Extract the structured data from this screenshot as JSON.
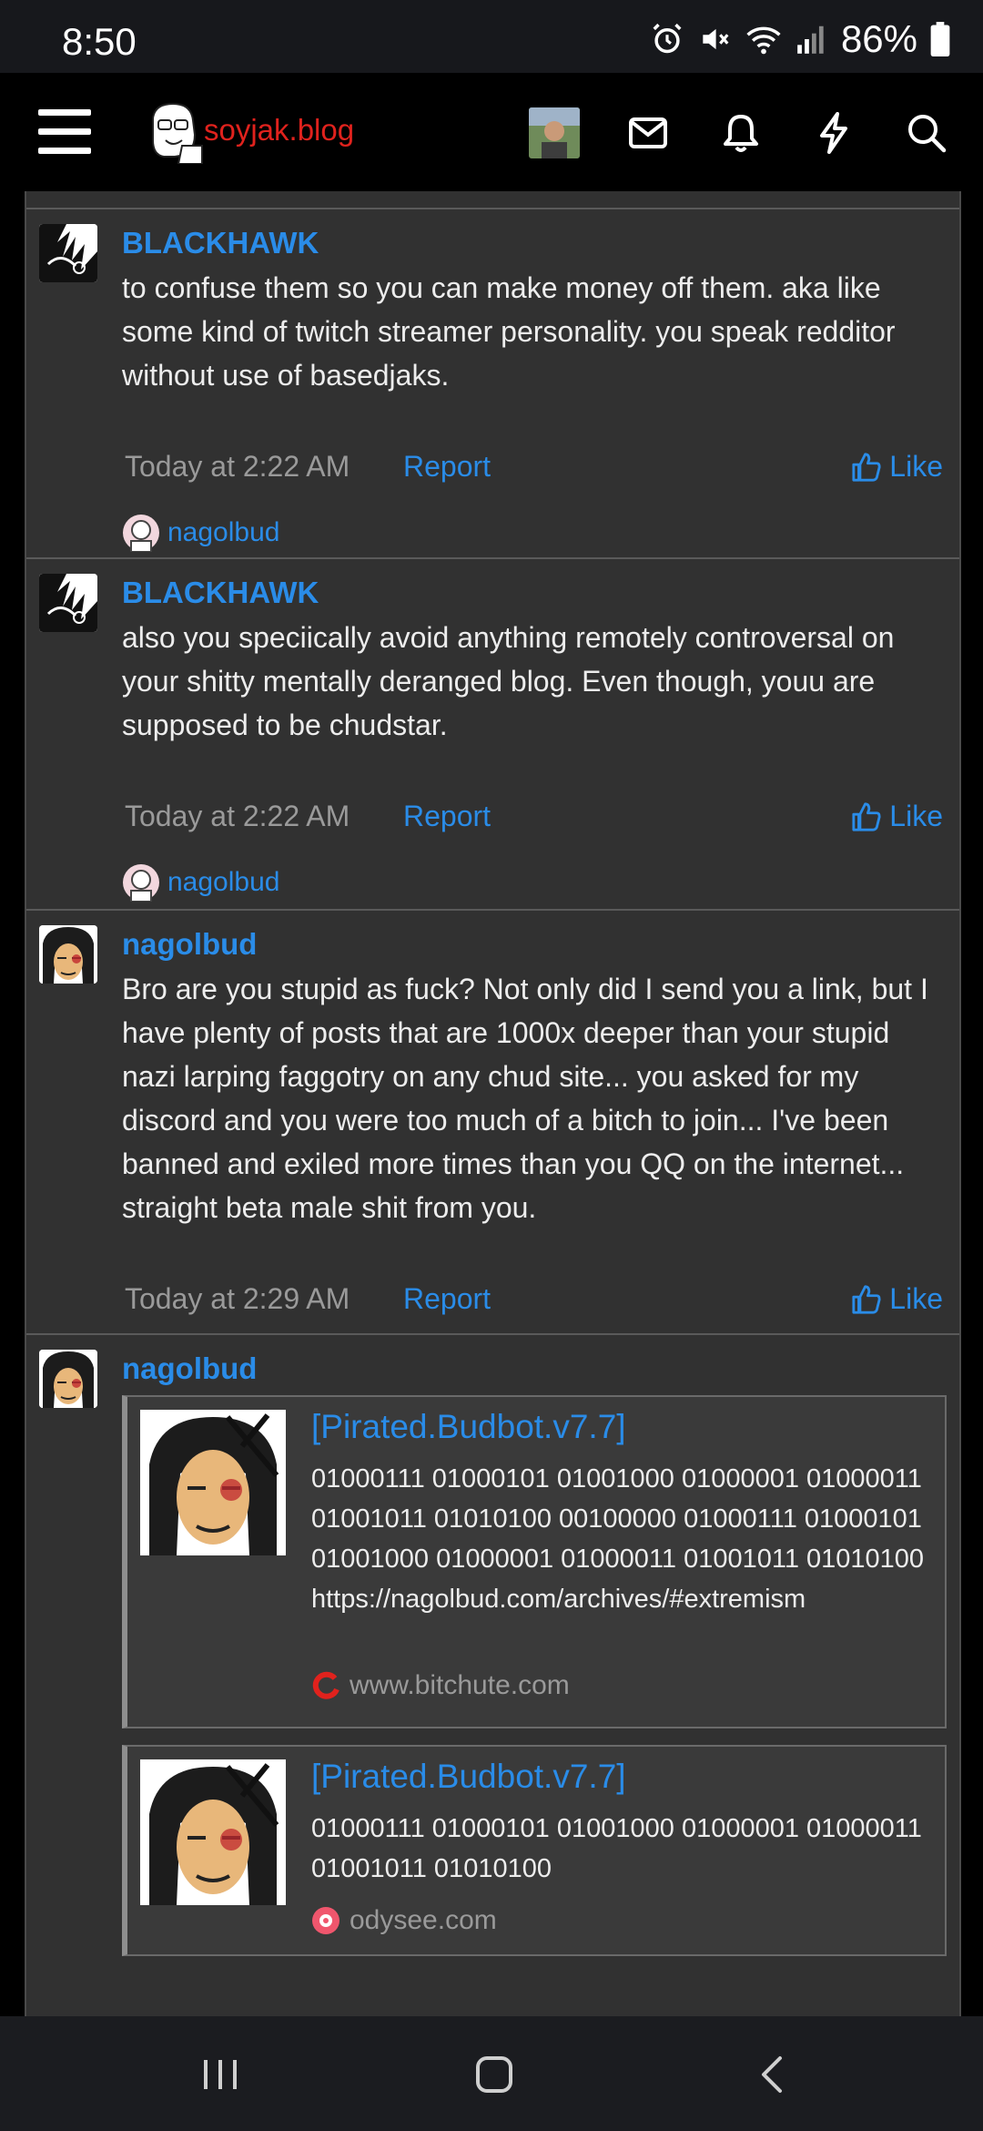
{
  "status_bar": {
    "time": "8:50",
    "battery": "86%"
  },
  "header": {
    "site_name": "soyjak.blog",
    "icons": [
      "menu-icon",
      "user-avatar",
      "mail-icon",
      "bell-icon",
      "bolt-icon",
      "search-icon"
    ]
  },
  "posts": [
    {
      "username": "BLACKHAWK",
      "text": "to confuse them so you can make money off them. aka like some kind of twitch streamer personality. you speak redditor without use of basedjaks.",
      "time": "Today at 2:22 AM",
      "report": "Report",
      "like": "Like",
      "liked_by": "nagolbud"
    },
    {
      "username": "BLACKHAWK",
      "text": "also you speciically avoid anything remotely controversal on your shitty mentally deranged blog. Even though, youu are supposed to be chudstar.",
      "time": "Today at 2:22 AM",
      "report": "Report",
      "like": "Like",
      "liked_by": "nagolbud"
    },
    {
      "username": "nagolbud",
      "text": "Bro are you stupid as fuck? Not only did I send you a link, but I have plenty of posts that are 1000x deeper than your stupid nazi larping faggotry on any chud site... you asked for my discord and you were too much of a bitch to join... I've been banned and exiled more times than you QQ on the internet... straight beta male shit from you.",
      "time": "Today at 2:29 AM",
      "report": "Report",
      "like": "Like"
    },
    {
      "username": "nagolbud",
      "embeds": [
        {
          "title": "[Pirated.Budbot.v7.7]",
          "description": "01000111 01000101 01001000 01000001 01000011 01001011 01010100 00100000 01000111 01000101 01001000 01000001 01000011 01001011 01010100 https://nagolbud.com/archives/#extremism",
          "site": "www.bitchute.com"
        },
        {
          "title": "[Pirated.Budbot.v7.7]",
          "description": "01000111 01000101 01001000 01000001 01000011 01001011 01010100",
          "site": "odysee.com"
        }
      ]
    }
  ],
  "colors": {
    "accent": "#2a8ce8",
    "brand": "#e0221d",
    "panel": "#313131",
    "background": "#000000"
  }
}
